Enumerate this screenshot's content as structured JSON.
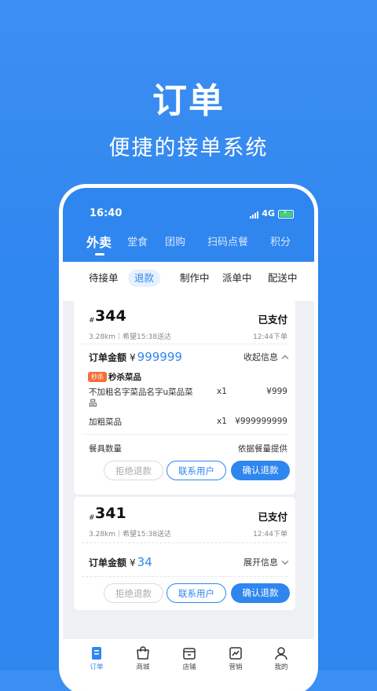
{
  "hero": {
    "title": "订单",
    "subtitle": "便捷的接单系统"
  },
  "status_bar": {
    "time": "16:40",
    "network": "4G"
  },
  "main_tabs": [
    "外卖",
    "堂食",
    "团购",
    "扫码点餐",
    "积分"
  ],
  "sub_tabs": [
    "待接单",
    "退款",
    "制作中",
    "派单中",
    "配送中"
  ],
  "orders": [
    {
      "hash": "#",
      "number": "344",
      "status": "已支付",
      "distance": "3.28km",
      "expected": "希望15:38送达",
      "order_time": "12:44下单",
      "amount_label": "订单金额",
      "currency": "¥",
      "amount": "999999",
      "info_toggle": "收起信息",
      "flash_badge": "秒杀",
      "flash_title": "秒杀菜品",
      "items": [
        {
          "name": "不加粗名字菜品名字u菜品菜品",
          "qty": "x1",
          "price": "¥999"
        },
        {
          "name": "加粗菜品",
          "qty": "x1",
          "price": "¥999999999"
        }
      ],
      "tableware_label": "餐具数量",
      "tableware_value": "依据餐量提供",
      "buttons": {
        "reject": "拒绝退款",
        "contact": "联系用户",
        "confirm": "确认退款"
      }
    },
    {
      "hash": "#",
      "number": "341",
      "status": "已支付",
      "distance": "3.28km",
      "expected": "希望15:38送达",
      "order_time": "12:44下单",
      "amount_label": "订单金额",
      "currency": "¥",
      "amount": "34",
      "info_toggle": "展开信息",
      "buttons": {
        "reject": "拒绝退款",
        "contact": "联系用户",
        "confirm": "确认退款"
      }
    }
  ],
  "bottom_nav": [
    {
      "label": "订单",
      "icon": "order-icon",
      "active": true
    },
    {
      "label": "商城",
      "icon": "shop-bag-icon"
    },
    {
      "label": "店铺",
      "icon": "store-icon"
    },
    {
      "label": "营销",
      "icon": "chart-icon"
    },
    {
      "label": "我的",
      "icon": "user-icon"
    }
  ],
  "colors": {
    "primary": "#2f86ef",
    "flash": "#f36e35",
    "battery": "#3fd56b"
  }
}
